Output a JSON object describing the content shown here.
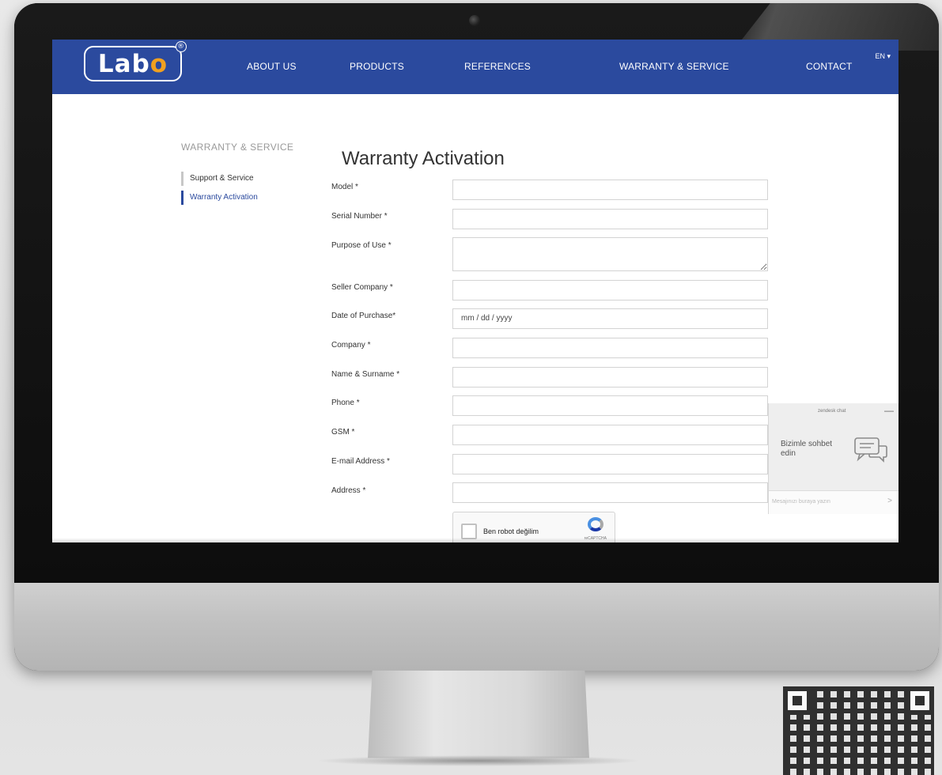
{
  "header": {
    "logo_text_main": "Lab",
    "logo_text_accent": "o",
    "logo_reg": "®",
    "nav": [
      "ABOUT US",
      "PRODUCTS",
      "REFERENCES",
      "WARRANTY & SERVICE",
      "CONTACT"
    ],
    "language": "EN ▾"
  },
  "sidebar": {
    "title": "WARRANTY & SERVICE",
    "items": [
      {
        "label": "Support & Service",
        "active": false
      },
      {
        "label": "Warranty Activation",
        "active": true
      }
    ]
  },
  "form": {
    "title": "Warranty Activation",
    "fields": [
      {
        "label": "Model *",
        "value": "",
        "placeholder": ""
      },
      {
        "label": "Serial Number *",
        "value": "",
        "placeholder": ""
      },
      {
        "label": "Purpose of Use *",
        "value": "",
        "placeholder": ""
      },
      {
        "label": "Seller Company *",
        "value": "",
        "placeholder": ""
      },
      {
        "label": "Date of Purchase*",
        "value": "",
        "placeholder": "mm / dd / yyyy"
      },
      {
        "label": "Company *",
        "value": "",
        "placeholder": ""
      },
      {
        "label": "Name & Surname *",
        "value": "",
        "placeholder": ""
      },
      {
        "label": "Phone *",
        "value": "",
        "placeholder": ""
      },
      {
        "label": "GSM *",
        "value": "",
        "placeholder": ""
      },
      {
        "label": "E-mail Address *",
        "value": "",
        "placeholder": ""
      },
      {
        "label": "Address *",
        "value": "",
        "placeholder": ""
      }
    ],
    "captcha": {
      "label": "Ben robot değilim",
      "brand": "reCAPTCHA"
    }
  },
  "chat": {
    "header": "zendesk chat",
    "minimize": "—",
    "message": "Bizimle sohbet edin",
    "input_placeholder": "Mesajınızı buraya yazın",
    "send": ">"
  },
  "colors": {
    "nav_bg": "#2b4a9e",
    "logo_accent": "#f0a020",
    "active_item": "#2b4a9e"
  }
}
